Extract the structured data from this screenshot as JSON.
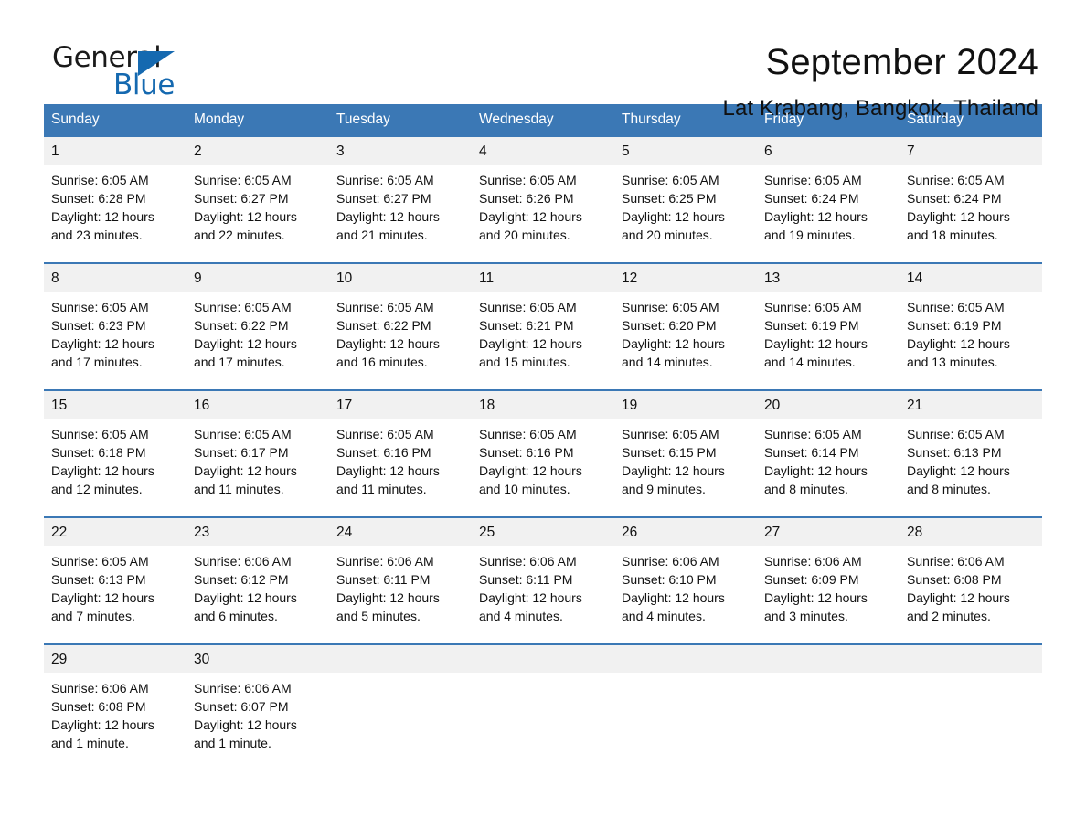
{
  "logo": {
    "word1": "General",
    "word2": "Blue",
    "accent_color": "#1569b0"
  },
  "header": {
    "month_year": "September 2024",
    "location": "Lat Krabang, Bangkok, Thailand"
  },
  "calendar": {
    "header_bg": "#3b78b5",
    "daynum_bg": "#f1f1f1",
    "weekday_names": [
      "Sunday",
      "Monday",
      "Tuesday",
      "Wednesday",
      "Thursday",
      "Friday",
      "Saturday"
    ],
    "weeks": [
      [
        {
          "day": "1",
          "sunrise": "Sunrise: 6:05 AM",
          "sunset": "Sunset: 6:28 PM",
          "daylight_line1": "Daylight: 12 hours",
          "daylight_line2": "and 23 minutes."
        },
        {
          "day": "2",
          "sunrise": "Sunrise: 6:05 AM",
          "sunset": "Sunset: 6:27 PM",
          "daylight_line1": "Daylight: 12 hours",
          "daylight_line2": "and 22 minutes."
        },
        {
          "day": "3",
          "sunrise": "Sunrise: 6:05 AM",
          "sunset": "Sunset: 6:27 PM",
          "daylight_line1": "Daylight: 12 hours",
          "daylight_line2": "and 21 minutes."
        },
        {
          "day": "4",
          "sunrise": "Sunrise: 6:05 AM",
          "sunset": "Sunset: 6:26 PM",
          "daylight_line1": "Daylight: 12 hours",
          "daylight_line2": "and 20 minutes."
        },
        {
          "day": "5",
          "sunrise": "Sunrise: 6:05 AM",
          "sunset": "Sunset: 6:25 PM",
          "daylight_line1": "Daylight: 12 hours",
          "daylight_line2": "and 20 minutes."
        },
        {
          "day": "6",
          "sunrise": "Sunrise: 6:05 AM",
          "sunset": "Sunset: 6:24 PM",
          "daylight_line1": "Daylight: 12 hours",
          "daylight_line2": "and 19 minutes."
        },
        {
          "day": "7",
          "sunrise": "Sunrise: 6:05 AM",
          "sunset": "Sunset: 6:24 PM",
          "daylight_line1": "Daylight: 12 hours",
          "daylight_line2": "and 18 minutes."
        }
      ],
      [
        {
          "day": "8",
          "sunrise": "Sunrise: 6:05 AM",
          "sunset": "Sunset: 6:23 PM",
          "daylight_line1": "Daylight: 12 hours",
          "daylight_line2": "and 17 minutes."
        },
        {
          "day": "9",
          "sunrise": "Sunrise: 6:05 AM",
          "sunset": "Sunset: 6:22 PM",
          "daylight_line1": "Daylight: 12 hours",
          "daylight_line2": "and 17 minutes."
        },
        {
          "day": "10",
          "sunrise": "Sunrise: 6:05 AM",
          "sunset": "Sunset: 6:22 PM",
          "daylight_line1": "Daylight: 12 hours",
          "daylight_line2": "and 16 minutes."
        },
        {
          "day": "11",
          "sunrise": "Sunrise: 6:05 AM",
          "sunset": "Sunset: 6:21 PM",
          "daylight_line1": "Daylight: 12 hours",
          "daylight_line2": "and 15 minutes."
        },
        {
          "day": "12",
          "sunrise": "Sunrise: 6:05 AM",
          "sunset": "Sunset: 6:20 PM",
          "daylight_line1": "Daylight: 12 hours",
          "daylight_line2": "and 14 minutes."
        },
        {
          "day": "13",
          "sunrise": "Sunrise: 6:05 AM",
          "sunset": "Sunset: 6:19 PM",
          "daylight_line1": "Daylight: 12 hours",
          "daylight_line2": "and 14 minutes."
        },
        {
          "day": "14",
          "sunrise": "Sunrise: 6:05 AM",
          "sunset": "Sunset: 6:19 PM",
          "daylight_line1": "Daylight: 12 hours",
          "daylight_line2": "and 13 minutes."
        }
      ],
      [
        {
          "day": "15",
          "sunrise": "Sunrise: 6:05 AM",
          "sunset": "Sunset: 6:18 PM",
          "daylight_line1": "Daylight: 12 hours",
          "daylight_line2": "and 12 minutes."
        },
        {
          "day": "16",
          "sunrise": "Sunrise: 6:05 AM",
          "sunset": "Sunset: 6:17 PM",
          "daylight_line1": "Daylight: 12 hours",
          "daylight_line2": "and 11 minutes."
        },
        {
          "day": "17",
          "sunrise": "Sunrise: 6:05 AM",
          "sunset": "Sunset: 6:16 PM",
          "daylight_line1": "Daylight: 12 hours",
          "daylight_line2": "and 11 minutes."
        },
        {
          "day": "18",
          "sunrise": "Sunrise: 6:05 AM",
          "sunset": "Sunset: 6:16 PM",
          "daylight_line1": "Daylight: 12 hours",
          "daylight_line2": "and 10 minutes."
        },
        {
          "day": "19",
          "sunrise": "Sunrise: 6:05 AM",
          "sunset": "Sunset: 6:15 PM",
          "daylight_line1": "Daylight: 12 hours",
          "daylight_line2": "and 9 minutes."
        },
        {
          "day": "20",
          "sunrise": "Sunrise: 6:05 AM",
          "sunset": "Sunset: 6:14 PM",
          "daylight_line1": "Daylight: 12 hours",
          "daylight_line2": "and 8 minutes."
        },
        {
          "day": "21",
          "sunrise": "Sunrise: 6:05 AM",
          "sunset": "Sunset: 6:13 PM",
          "daylight_line1": "Daylight: 12 hours",
          "daylight_line2": "and 8 minutes."
        }
      ],
      [
        {
          "day": "22",
          "sunrise": "Sunrise: 6:05 AM",
          "sunset": "Sunset: 6:13 PM",
          "daylight_line1": "Daylight: 12 hours",
          "daylight_line2": "and 7 minutes."
        },
        {
          "day": "23",
          "sunrise": "Sunrise: 6:06 AM",
          "sunset": "Sunset: 6:12 PM",
          "daylight_line1": "Daylight: 12 hours",
          "daylight_line2": "and 6 minutes."
        },
        {
          "day": "24",
          "sunrise": "Sunrise: 6:06 AM",
          "sunset": "Sunset: 6:11 PM",
          "daylight_line1": "Daylight: 12 hours",
          "daylight_line2": "and 5 minutes."
        },
        {
          "day": "25",
          "sunrise": "Sunrise: 6:06 AM",
          "sunset": "Sunset: 6:11 PM",
          "daylight_line1": "Daylight: 12 hours",
          "daylight_line2": "and 4 minutes."
        },
        {
          "day": "26",
          "sunrise": "Sunrise: 6:06 AM",
          "sunset": "Sunset: 6:10 PM",
          "daylight_line1": "Daylight: 12 hours",
          "daylight_line2": "and 4 minutes."
        },
        {
          "day": "27",
          "sunrise": "Sunrise: 6:06 AM",
          "sunset": "Sunset: 6:09 PM",
          "daylight_line1": "Daylight: 12 hours",
          "daylight_line2": "and 3 minutes."
        },
        {
          "day": "28",
          "sunrise": "Sunrise: 6:06 AM",
          "sunset": "Sunset: 6:08 PM",
          "daylight_line1": "Daylight: 12 hours",
          "daylight_line2": "and 2 minutes."
        }
      ],
      [
        {
          "day": "29",
          "sunrise": "Sunrise: 6:06 AM",
          "sunset": "Sunset: 6:08 PM",
          "daylight_line1": "Daylight: 12 hours",
          "daylight_line2": "and 1 minute."
        },
        {
          "day": "30",
          "sunrise": "Sunrise: 6:06 AM",
          "sunset": "Sunset: 6:07 PM",
          "daylight_line1": "Daylight: 12 hours",
          "daylight_line2": "and 1 minute."
        },
        {
          "day": "",
          "sunrise": "",
          "sunset": "",
          "daylight_line1": "",
          "daylight_line2": ""
        },
        {
          "day": "",
          "sunrise": "",
          "sunset": "",
          "daylight_line1": "",
          "daylight_line2": ""
        },
        {
          "day": "",
          "sunrise": "",
          "sunset": "",
          "daylight_line1": "",
          "daylight_line2": ""
        },
        {
          "day": "",
          "sunrise": "",
          "sunset": "",
          "daylight_line1": "",
          "daylight_line2": ""
        },
        {
          "day": "",
          "sunrise": "",
          "sunset": "",
          "daylight_line1": "",
          "daylight_line2": ""
        }
      ]
    ]
  }
}
